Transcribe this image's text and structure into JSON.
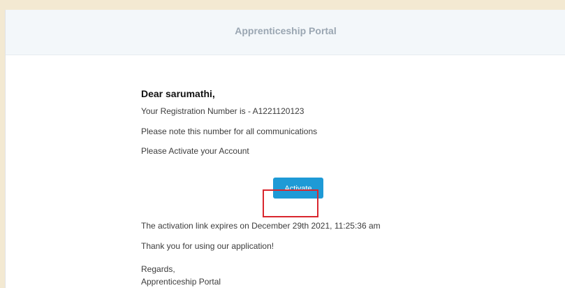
{
  "header": {
    "title": "Apprenticeship Portal"
  },
  "email": {
    "greeting": "Dear sarumathi,",
    "registration_line": "Your Registration Number is - A1221120123",
    "note_line": "Please note this number for all communications",
    "activate_prompt": "Please Activate your Account",
    "activate_button_label": "Activate",
    "expiry_line": "The activation link expires on December 29th 2021, 11:25:36 am",
    "thanks_line": "Thank you for using our application!",
    "regards": "Regards,",
    "signature": "Apprenticeship Portal"
  },
  "colors": {
    "page_bg": "#f3e9d2",
    "header_bg": "#f3f7fa",
    "button_bg": "#1e9ad6",
    "highlight": "#d9262e"
  }
}
